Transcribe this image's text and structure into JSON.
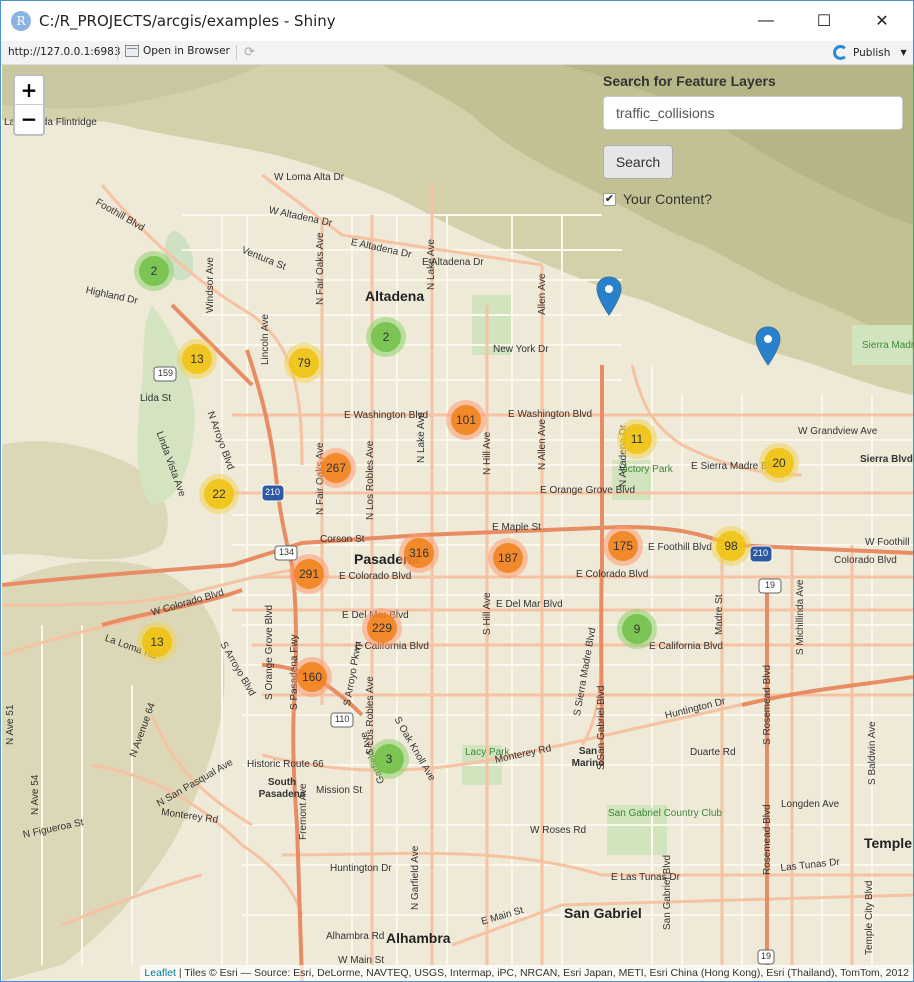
{
  "window": {
    "title": "C:/R_PROJECTS/arcgis/examples - Shiny",
    "app_icon": "R",
    "controls": {
      "minimize": "—",
      "maximize": "☐",
      "close": "✕"
    }
  },
  "toolbar": {
    "url": "http://127.0.0.1:6983",
    "open_in_browser": "Open in Browser",
    "publish": "Publish"
  },
  "map": {
    "zoom_in": "+",
    "zoom_out": "−",
    "clusters": [
      {
        "count": "2",
        "size": "small"
      },
      {
        "count": "13",
        "size": "medium"
      },
      {
        "count": "79",
        "size": "medium"
      },
      {
        "count": "2",
        "size": "small"
      },
      {
        "count": "101",
        "size": "large"
      },
      {
        "count": "11",
        "size": "medium"
      },
      {
        "count": "20",
        "size": "medium"
      },
      {
        "count": "267",
        "size": "large"
      },
      {
        "count": "22",
        "size": "medium"
      },
      {
        "count": "316",
        "size": "large"
      },
      {
        "count": "187",
        "size": "large"
      },
      {
        "count": "175",
        "size": "large"
      },
      {
        "count": "98",
        "size": "medium"
      },
      {
        "count": "291",
        "size": "large"
      },
      {
        "count": "13",
        "size": "medium"
      },
      {
        "count": "229",
        "size": "large"
      },
      {
        "count": "9",
        "size": "small"
      },
      {
        "count": "160",
        "size": "large"
      },
      {
        "count": "3",
        "size": "small"
      }
    ],
    "labels": {
      "altadena": "Altadena",
      "pasadena": "Pasadena",
      "south_pasadena": "South Pasadena",
      "san_marino": "San Marino",
      "san_gabriel": "San Gabriel",
      "alhambra": "Alhambra",
      "temple": "Temple",
      "sierra_madre": "Sierra Madre",
      "sierra_madre_park": "Sierra Madre City Park",
      "lacy_park": "Lacy Park",
      "victory_park": "Victory Park",
      "san_gabriel_cc": "San Gabriel Country Club",
      "la_canada": "La Cañada Flintridge",
      "w_loma_alta": "W Loma Alta Dr",
      "w_altadena": "W Altadena Dr",
      "e_altadena": "E Altadena Dr",
      "new_york": "New York Dr",
      "e_washington_w": "E Washington Blvd",
      "e_washington_e": "E Washington Blvd",
      "e_orange_grove": "E Orange Grove Blvd",
      "e_sierra_madre": "E Sierra Madre Blvd",
      "e_maple": "E Maple St",
      "corson": "Corson St",
      "e_foothill": "E Foothill Blvd",
      "w_foothill": "W Foothill",
      "colorado_w": "E Colorado Blvd",
      "colorado_e": "E Colorado Blvd",
      "colorado_far": "Colorado Blvd",
      "w_colorado": "W Colorado Blvd",
      "e_del_mar_w": "E Del Mar Blvd",
      "e_del_mar_e": "E Del Mar Blvd",
      "e_california_w": "E California Blvd",
      "e_california_e": "E California Blvd",
      "huntington_w": "Huntington Dr",
      "huntington_e": "Huntington Dr",
      "monterey_w": "Monterey Rd",
      "monterey_e": "Monterey Rd",
      "mission": "Mission St",
      "historic_66": "Historic Route 66",
      "w_roses": "W Roses Rd",
      "e_las_tunas": "E Las Tunas Dr",
      "las_tunas": "Las Tunas Dr",
      "e_main": "E Main St",
      "w_main": "W Main St",
      "alhambra_rd": "Alhambra Rd",
      "longden": "Longden Ave",
      "duarte": "Duarte Rd",
      "w_grandview": "W Grandview Ave",
      "sierra_blvd": "Sierra Blvd",
      "lida": "Lida St",
      "ventura": "Ventura St",
      "highland": "Highland Dr",
      "foothill_blvd": "Foothill Blvd",
      "n_lake": "N Lake Ave",
      "n_hill": "N Hill Ave",
      "n_allen": "N Allen Ave",
      "n_altadena_dr": "N Altadena Dr",
      "n_fair_oaks": "N Fair Oaks Ave",
      "n_los_robles": "N Los Robles Ave",
      "lincoln": "Lincoln Ave",
      "n_arroyo": "N Arroyo Blvd",
      "linda_vista": "Linda Vista Ave",
      "windsor": "Windsor Ave",
      "rosemead": "Rosemead Blvd",
      "s_rosemead": "S Rosemead Blvd",
      "s_michillinda": "S Michillinda Ave",
      "madre": "Madre St",
      "s_san_gabriel": "S San Gabriel Blvd",
      "s_sierra_madre": "S Sierra Madre Blvd",
      "s_hill": "S Hill Ave",
      "s_los_robles": "S Los Robles Ave",
      "s_orange_grove": "S Orange Grove Blvd",
      "s_arroyo": "S Arroyo Blvd",
      "pasadena_fwy": "S Pasadena Fwy",
      "n_figueroa": "N Figueroa St",
      "la_loma": "La Loma Rd",
      "n_avenue_64": "N Avenue 64",
      "n_ave_54": "N Ave 54",
      "n_ave_51": "N Ave 51",
      "s_baldwin": "S Baldwin Ave",
      "temple_city": "Temple City Blvd",
      "bldwin": "Baldwin Ave",
      "hw_210": "210",
      "hw_134": "134",
      "hw_110": "110",
      "hw_159": "159",
      "hw_19a": "19",
      "hw_19b": "19",
      "hw_210e": "210"
    },
    "attribution_link": "Leaflet",
    "attribution_text": " | Tiles © Esri — Source: Esri, DeLorme, NAVTEQ, USGS, Intermap, iPC, NRCAN, Esri Japan, METI, Esri China (Hong Kong), Esri (Thailand), TomTom, 2012"
  },
  "panel": {
    "label": "Search for Feature Layers",
    "input_value": "traffic_collisions",
    "search_button": "Search",
    "checkbox_label": "Your Content?",
    "checkbox_checked": true
  },
  "colors": {
    "cluster_small": "#71c148",
    "cluster_medium": "#f0c20c",
    "cluster_large": "#f18017",
    "pin": "#2a81cb",
    "freeway": "#e98c68",
    "major_road": "#f3b899",
    "terrain": "#c6c59f"
  }
}
